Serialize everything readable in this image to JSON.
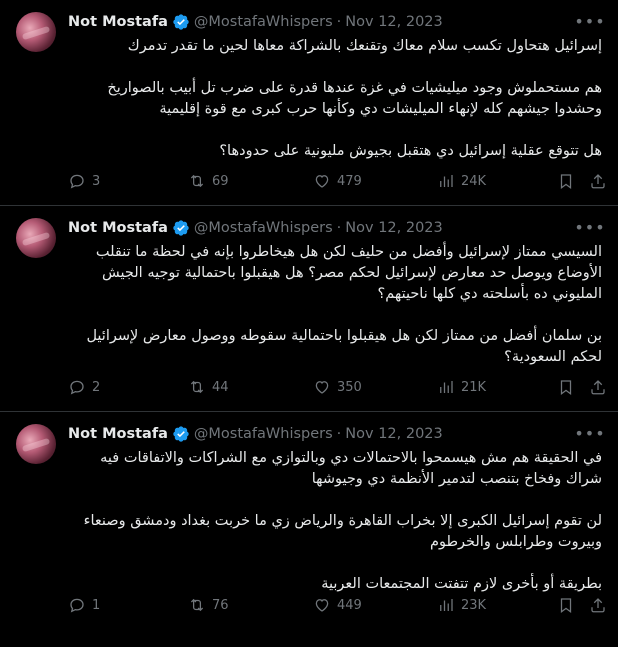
{
  "colors": {
    "background": "#000000",
    "text": "#e7e9ea",
    "muted": "#71767b",
    "verified": "#1d9bf0",
    "divider": "#2f3336"
  },
  "tweets": [
    {
      "name": "Not Mostafa",
      "handle": "@MostafaWhispers",
      "separator": "·",
      "date": "Nov 12, 2023",
      "paragraphs": [
        "إسرائيل هتحاول تكسب سلام معاك وتقنعك بالشراكة معاها لحين ما تقدر تدمرك",
        "هم مستحملوش وجود ميليشيات في غزة عندها قدرة على ضرب تل أبيب بالصواريخ وحشدوا جيشهم كله لإنهاء الميليشات دي وكأنها حرب كبرى مع قوة إقليمية",
        "هل تتوقع عقلية إسرائيل دي هتقبل بجيوش مليونية على حدودها؟"
      ],
      "replies": "3",
      "retweets": "69",
      "likes": "479",
      "views": "24K"
    },
    {
      "name": "Not Mostafa",
      "handle": "@MostafaWhispers",
      "separator": "·",
      "date": "Nov 12, 2023",
      "paragraphs": [
        "السيسي ممتاز لإسرائيل وأفضل من حليف لكن هل هيخاطروا بإنه في لحظة ما تنقلب الأوضاع ويوصل حد معارض لإسرائيل لحكم مصر؟ هل هيقبلوا باحتمالية توجيه الجيش المليوني ده بأسلحته دي كلها ناحيتهم؟",
        "بن سلمان أفضل من ممتاز لكن هل هيقبلوا باحتمالية سقوطه ووصول معارض لإسرائيل لحكم السعودية؟"
      ],
      "replies": "2",
      "retweets": "44",
      "likes": "350",
      "views": "21K"
    },
    {
      "name": "Not Mostafa",
      "handle": "@MostafaWhispers",
      "separator": "·",
      "date": "Nov 12, 2023",
      "paragraphs": [
        "في الحقيقة هم مش هيسمحوا بالاحتمالات دي وبالتوازي مع الشراكات والاتفاقات فيه شراك وفخاخ بتنصب لتدمير الأنظمة دي وجيوشها",
        "لن تقوم إسرائيل الكبرى إلا بخراب القاهرة والرياض زي ما خربت بغداد ودمشق وصنعاء وبيروت وطرابلس والخرطوم",
        "بطريقة أو بأخرى لازم تتفتت المجتمعات العربية"
      ],
      "replies": "1",
      "retweets": "76",
      "likes": "449",
      "views": "23K"
    }
  ]
}
